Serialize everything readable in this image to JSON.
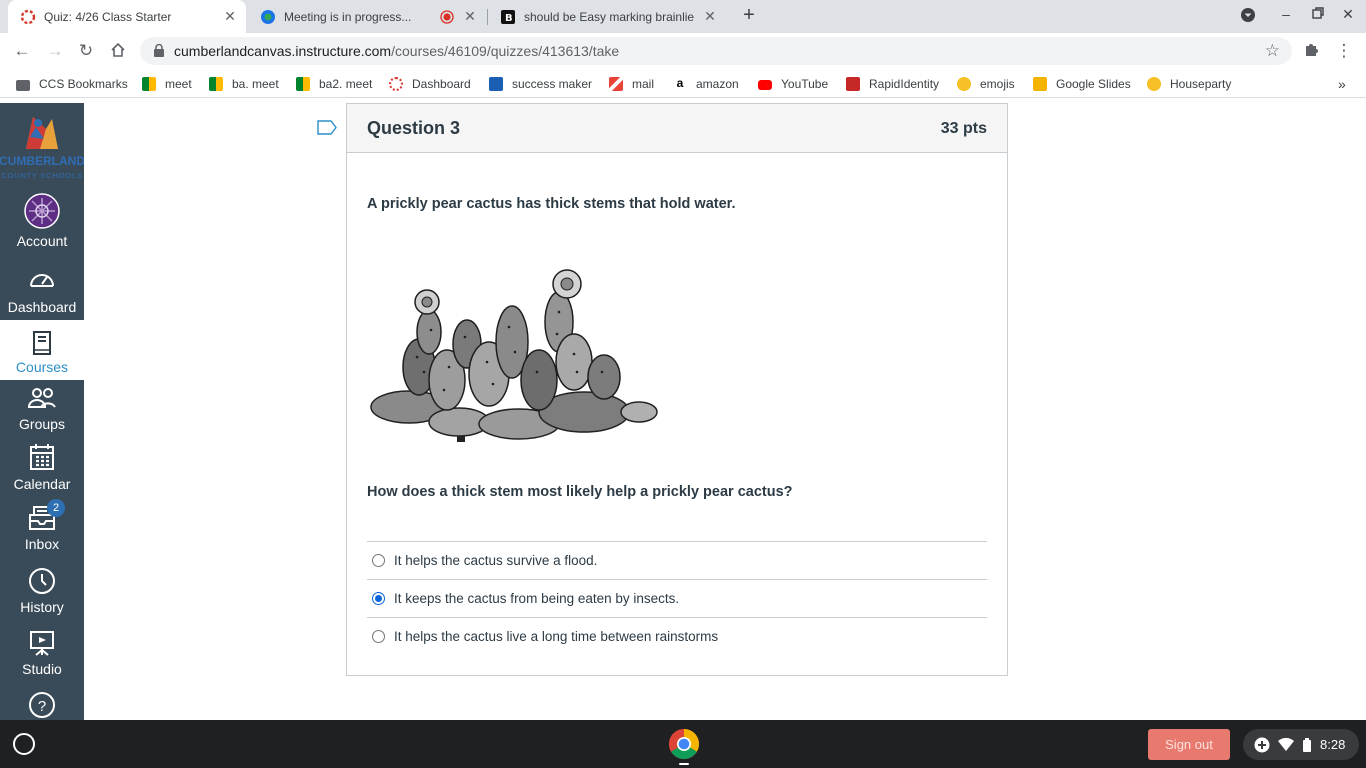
{
  "browser": {
    "tabs": [
      {
        "title": "Quiz: 4/26 Class Starter",
        "active": true
      },
      {
        "title": "Meeting is in progress...",
        "active": false,
        "recording": true
      },
      {
        "title": "should be Easy marking brainlie",
        "active": false
      }
    ],
    "url_host": "cumberlandcanvas.instructure.com",
    "url_path": "/courses/46109/quizzes/413613/take",
    "bookmarks": [
      {
        "label": "CCS Bookmarks",
        "icon": "folder-icon"
      },
      {
        "label": "meet",
        "icon": "meet-icon"
      },
      {
        "label": "ba. meet",
        "icon": "meet-icon"
      },
      {
        "label": "ba2. meet",
        "icon": "meet-icon"
      },
      {
        "label": "Dashboard",
        "icon": "canvas-icon"
      },
      {
        "label": "success maker",
        "icon": "successmaker-icon"
      },
      {
        "label": "mail",
        "icon": "gmail-icon"
      },
      {
        "label": "amazon",
        "icon": "amazon-icon"
      },
      {
        "label": "YouTube",
        "icon": "youtube-icon"
      },
      {
        "label": "RapidIdentity",
        "icon": "rapididentity-icon"
      },
      {
        "label": "emojis",
        "icon": "emoji-icon"
      },
      {
        "label": "Google Slides",
        "icon": "slides-icon"
      },
      {
        "label": "Houseparty",
        "icon": "houseparty-icon"
      }
    ]
  },
  "nav": {
    "logo_top": "CUMBERLAND",
    "logo_bottom": "COUNTY SCHOOLS",
    "items": [
      {
        "label": "Account",
        "icon": "account-avatar-icon"
      },
      {
        "label": "Dashboard",
        "icon": "dashboard-icon"
      },
      {
        "label": "Courses",
        "icon": "courses-icon",
        "active": true
      },
      {
        "label": "Groups",
        "icon": "groups-icon"
      },
      {
        "label": "Calendar",
        "icon": "calendar-icon"
      },
      {
        "label": "Inbox",
        "icon": "inbox-icon",
        "badge": "2"
      },
      {
        "label": "History",
        "icon": "history-icon"
      },
      {
        "label": "Studio",
        "icon": "studio-icon"
      }
    ]
  },
  "question": {
    "title": "Question 3",
    "points": "33 pts",
    "text": "A prickly pear cactus has thick stems that hold water.",
    "image": "prickly-pear-cactus-illustration",
    "prompt": "How does a thick stem most likely help a prickly pear cactus?",
    "answers": [
      {
        "text": "It helps the cactus survive a flood.",
        "selected": false
      },
      {
        "text": "It keeps the cactus from being eaten by insects.",
        "selected": true
      },
      {
        "text": "It helps the cactus live a long time between rainstorms",
        "selected": false
      }
    ]
  },
  "shelf": {
    "signout_label": "Sign out",
    "time": "8:28"
  },
  "colors": {
    "nav_bg": "#394b58",
    "accent": "#2d8fc9",
    "radio_selected": "#0b65d8",
    "signout": "#e8796e"
  }
}
